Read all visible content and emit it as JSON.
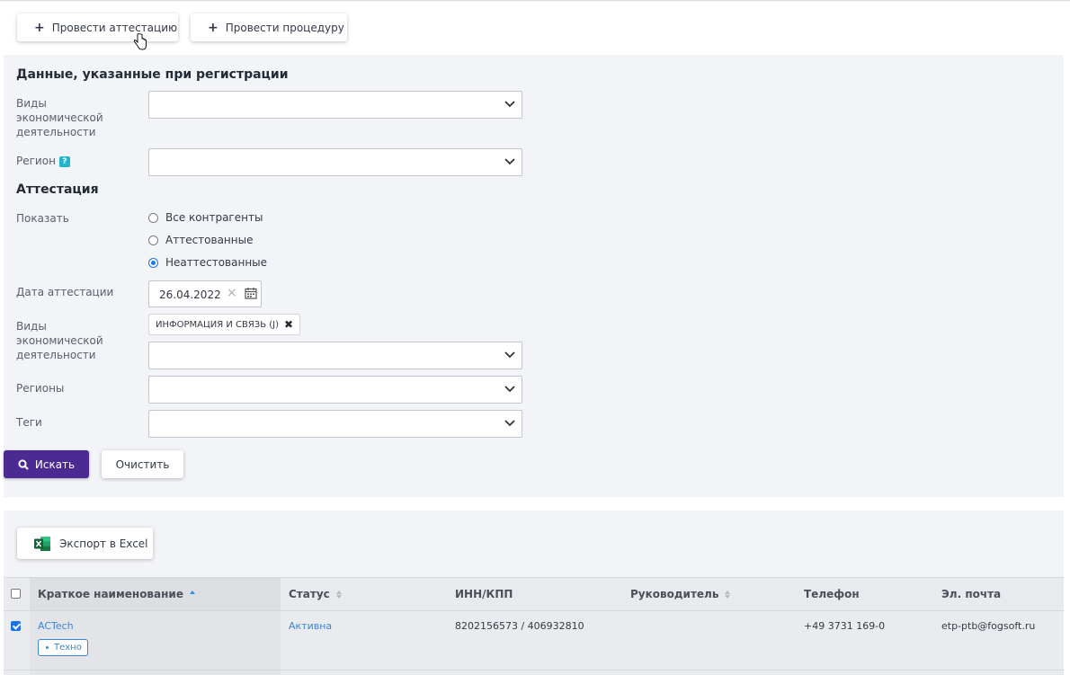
{
  "toolbar": {
    "attestation_button": "Провести аттестацию",
    "procedure_button": "Провести процедуру"
  },
  "registration": {
    "title": "Данные, указанные при регистрации",
    "activity_label": "Виды экономической деятельности",
    "region_label": "Регион",
    "region_help": "?"
  },
  "attestation": {
    "title": "Аттестация",
    "show_label": "Показать",
    "options": [
      "Все контрагенты",
      "Аттестованные",
      "Неаттестованные"
    ],
    "selected_option": "Неаттестованные",
    "date_label": "Дата аттестации",
    "date_value": "26.04.2022",
    "activity_label": "Виды экономической деятельности",
    "activity_chip": "ИНФОРМАЦИЯ И СВЯЗЬ (J)",
    "regions_label": "Регионы",
    "tags_label": "Теги"
  },
  "actions": {
    "search": "Искать",
    "clear": "Очистить",
    "export": "Экспорт в Excel"
  },
  "table": {
    "columns": [
      "Краткое наименование",
      "Статус",
      "ИНН/КПП",
      "Руководитель",
      "Телефон",
      "Эл. почта"
    ],
    "rows": [
      {
        "checked": true,
        "name": "ACTech",
        "tag": "Техно",
        "status": "Активна",
        "inn": "8202156573 / 406932810",
        "head": "",
        "phone": "+49 3731 169-0",
        "email": "etp-ptb@fogsoft.ru"
      }
    ]
  },
  "colors": {
    "primary": "#4b2a91",
    "link": "#3a86d6",
    "panel": "#f3f4f8",
    "excel": "#1d6f42"
  }
}
